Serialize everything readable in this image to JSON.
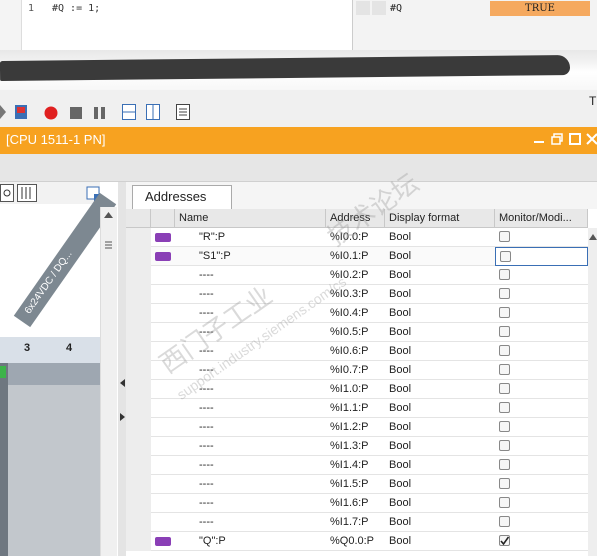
{
  "code": {
    "line_number": "1",
    "text": "#Q := 1;"
  },
  "monitor": {
    "variable": "#Q",
    "value": "TRUE"
  },
  "toolbar": {
    "right_text": "T"
  },
  "window": {
    "title": "[CPU 1511-1 PN]"
  },
  "device_view": {
    "module_label": "6x24VDC / DQ...",
    "slot_numbers": [
      "3",
      "4"
    ]
  },
  "tabs": {
    "addresses": "Addresses"
  },
  "table": {
    "columns": [
      "Name",
      "Address",
      "Display format",
      "Monitor/Modi..."
    ],
    "rows": [
      {
        "name": "\"R\":P",
        "address": "%I0.0:P",
        "format": "Bool",
        "tag": true,
        "checked": false,
        "selected": false
      },
      {
        "name": "\"S1\":P",
        "address": "%I0.1:P",
        "format": "Bool",
        "tag": true,
        "checked": false,
        "selected": true
      },
      {
        "name": "----",
        "address": "%I0.2:P",
        "format": "Bool",
        "tag": false,
        "checked": false,
        "selected": false
      },
      {
        "name": "----",
        "address": "%I0.3:P",
        "format": "Bool",
        "tag": false,
        "checked": false,
        "selected": false
      },
      {
        "name": "----",
        "address": "%I0.4:P",
        "format": "Bool",
        "tag": false,
        "checked": false,
        "selected": false
      },
      {
        "name": "----",
        "address": "%I0.5:P",
        "format": "Bool",
        "tag": false,
        "checked": false,
        "selected": false
      },
      {
        "name": "----",
        "address": "%I0.6:P",
        "format": "Bool",
        "tag": false,
        "checked": false,
        "selected": false
      },
      {
        "name": "----",
        "address": "%I0.7:P",
        "format": "Bool",
        "tag": false,
        "checked": false,
        "selected": false
      },
      {
        "name": "----",
        "address": "%I1.0:P",
        "format": "Bool",
        "tag": false,
        "checked": false,
        "selected": false
      },
      {
        "name": "----",
        "address": "%I1.1:P",
        "format": "Bool",
        "tag": false,
        "checked": false,
        "selected": false
      },
      {
        "name": "----",
        "address": "%I1.2:P",
        "format": "Bool",
        "tag": false,
        "checked": false,
        "selected": false
      },
      {
        "name": "----",
        "address": "%I1.3:P",
        "format": "Bool",
        "tag": false,
        "checked": false,
        "selected": false
      },
      {
        "name": "----",
        "address": "%I1.4:P",
        "format": "Bool",
        "tag": false,
        "checked": false,
        "selected": false
      },
      {
        "name": "----",
        "address": "%I1.5:P",
        "format": "Bool",
        "tag": false,
        "checked": false,
        "selected": false
      },
      {
        "name": "----",
        "address": "%I1.6:P",
        "format": "Bool",
        "tag": false,
        "checked": false,
        "selected": false
      },
      {
        "name": "----",
        "address": "%I1.7:P",
        "format": "Bool",
        "tag": false,
        "checked": false,
        "selected": false
      },
      {
        "name": "\"Q\":P",
        "address": "%Q0.0:P",
        "format": "Bool",
        "tag": true,
        "checked": true,
        "selected": false
      }
    ]
  },
  "watermark": {
    "text1": "西门子工业",
    "text2": "support.industry.siemens.com/cs",
    "text3": "技术论坛"
  },
  "colors": {
    "title_bar": "#f7a220",
    "monitor_true": "#f5a95f",
    "tag_icon": "#8a3fb6",
    "record_button": "#e02020"
  }
}
